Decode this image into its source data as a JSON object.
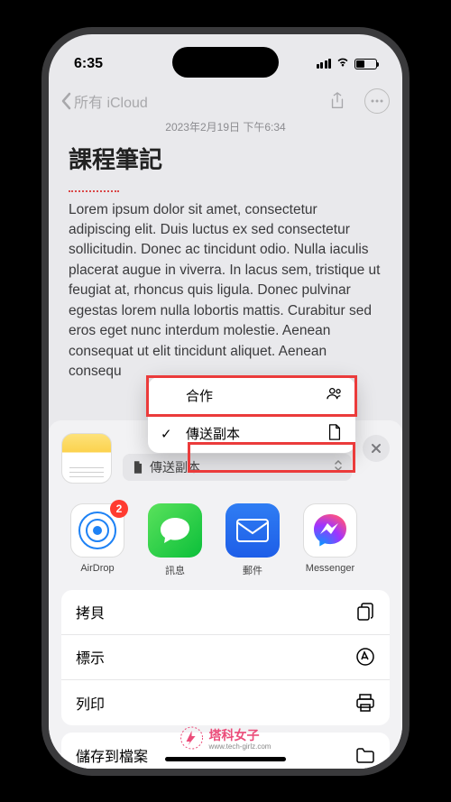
{
  "status": {
    "time": "6:35"
  },
  "nav": {
    "back_label": "所有 iCloud"
  },
  "note": {
    "timestamp": "2023年2月19日 下午6:34",
    "title": "課程筆記",
    "body": "Lorem ipsum dolor sit amet, consectetur adipiscing elit. Duis luctus ex sed consectetur sollicitudin. Donec ac tincidunt odio. Nulla iaculis placerat augue in viverra. In lacus sem, tristique ut feugiat at, rhoncus quis ligula. Donec pulvinar egestas lorem nulla lobortis mattis. Curabitur sed eros eget nunc interdum molestie. Aenean consequat ut elit tincidunt aliquet. Aenean consequ"
  },
  "dropdown": {
    "items": [
      {
        "label": "合作",
        "icon": "people-icon"
      },
      {
        "label": "傳送副本",
        "icon": "document-icon",
        "checked": true
      }
    ]
  },
  "sheet": {
    "mode_label": "傳送副本",
    "badge": "2",
    "apps": [
      {
        "label": "AirDrop"
      },
      {
        "label": "訊息"
      },
      {
        "label": "郵件"
      },
      {
        "label": "Messenger"
      }
    ],
    "actions": [
      {
        "label": "拷貝",
        "icon": "copy-icon"
      },
      {
        "label": "標示",
        "icon": "markup-icon"
      },
      {
        "label": "列印",
        "icon": "print-icon"
      }
    ],
    "save_action": {
      "label": "儲存到檔案",
      "icon": "folder-icon"
    }
  },
  "watermark": {
    "brand": "塔科女子",
    "url": "www.tech-girlz.com"
  }
}
